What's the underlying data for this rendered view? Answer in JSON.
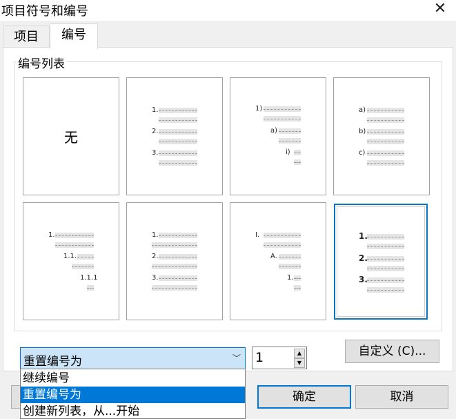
{
  "window": {
    "title": "项目符号和编号"
  },
  "tabs": [
    {
      "label": "项目"
    },
    {
      "label": "编号"
    }
  ],
  "group": {
    "label": "编号列表"
  },
  "gallery": {
    "none_label": "无",
    "styles": [
      {
        "name": "numeric-period",
        "markers": [
          "1.",
          "2.",
          "3."
        ]
      },
      {
        "name": "nested-paren",
        "markers": [
          "1)",
          "a)",
          "i)"
        ]
      },
      {
        "name": "alpha-paren",
        "markers": [
          "a)",
          "b)",
          "c)"
        ]
      },
      {
        "name": "legal-outline",
        "markers": [
          "1.",
          "1.1.",
          "1.1.1"
        ]
      },
      {
        "name": "numeric-period-long",
        "markers": [
          "1.",
          "2.",
          "3."
        ]
      },
      {
        "name": "roman-outline",
        "markers": [
          "I.",
          "A.",
          "1."
        ]
      },
      {
        "name": "bold-numeric",
        "markers": [
          "1.",
          "2.",
          "3."
        ]
      }
    ]
  },
  "restart": {
    "selected": "重置编号为",
    "value": "1",
    "options": [
      "继续编号",
      "重置编号为",
      "创建新列表，从...开始"
    ],
    "highlighted": "重置编号为"
  },
  "buttons": {
    "customize": "自定义 (C)...",
    "ok": "确定",
    "cancel": "取消"
  },
  "colors": {
    "selection": "#0078d7",
    "combo_bg": "#cce4f7"
  }
}
